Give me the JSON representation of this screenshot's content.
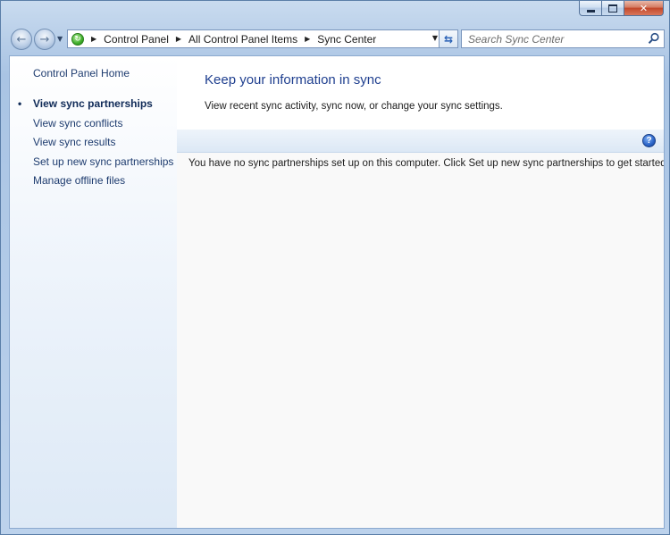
{
  "window": {
    "caption_min": "",
    "caption_max": "",
    "caption_close": "✕"
  },
  "nav": {
    "back_icon": "back-arrow-icon",
    "forward_icon": "forward-arrow-icon",
    "refresh_icon": "refresh-icon"
  },
  "breadcrumb": {
    "items": [
      "Control Panel",
      "All Control Panel Items",
      "Sync Center"
    ]
  },
  "search": {
    "placeholder": "Search Sync Center"
  },
  "sidebar": {
    "home": "Control Panel Home",
    "items": [
      {
        "label": "View sync partnerships",
        "active": true
      },
      {
        "label": "View sync conflicts",
        "active": false
      },
      {
        "label": "View sync results",
        "active": false
      },
      {
        "label": "Set up new sync partnerships",
        "active": false
      },
      {
        "label": "Manage offline files",
        "active": false
      }
    ]
  },
  "main": {
    "title": "Keep your information in sync",
    "description": "View recent sync activity, sync now, or change your sync settings.",
    "help_label": "?",
    "empty_message": "You have no sync partnerships set up on this computer. Click Set up new sync partnerships to get started."
  },
  "colors": {
    "accent": "#1f3f8f",
    "link": "#1e3c6f"
  }
}
